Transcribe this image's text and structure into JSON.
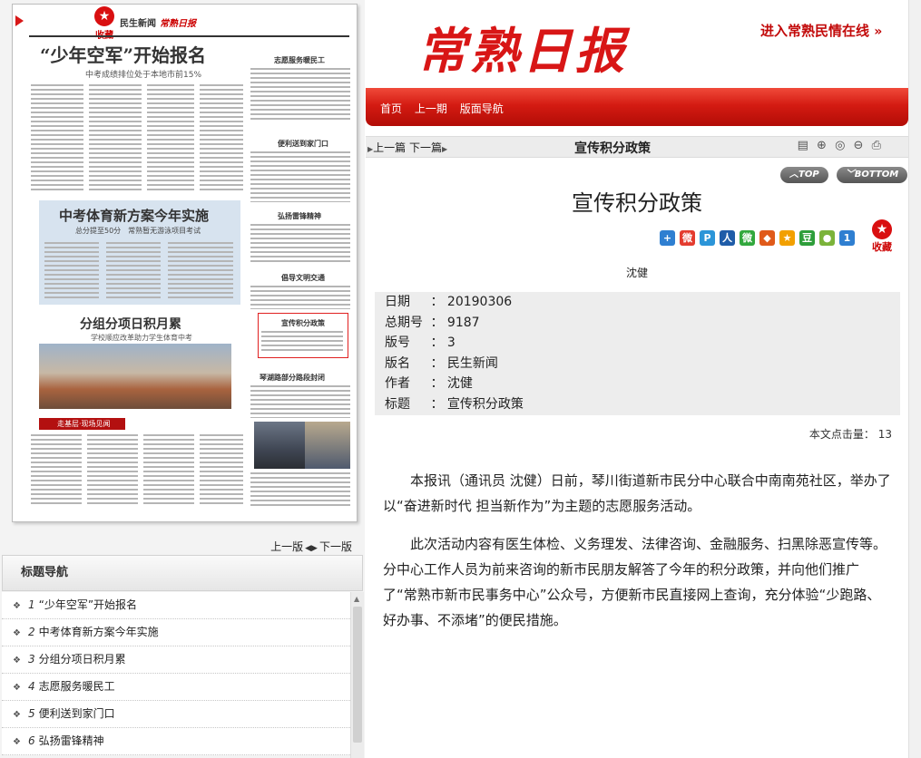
{
  "paper": {
    "fav_label": "收藏",
    "masthead": "民生新闻",
    "masthead_logo": "常熟日报",
    "headline1": "“少年空军”开始报名",
    "headline1_sub": "中考成绩排位处于本地市前15%",
    "headline2": "中考体育新方案今年实施",
    "headline2_sub": "总分提至50分　常熟暂无游泳项目考试",
    "headline3": "分组分项日积月累",
    "headline3_sub": "学校顺应改革助力学生体育中考",
    "banner": "走基层·现场见闻",
    "side_titles": [
      "志愿服务暖民工",
      "便利送到家门口",
      "弘扬雷锋精神",
      "倡导文明交通",
      "宣传积分政策",
      "琴湖路部分路段封闭"
    ]
  },
  "page_nav": {
    "prev": "上一版",
    "next": "下一版"
  },
  "title_nav": {
    "header": "标题导航",
    "items": [
      {
        "num": "1",
        "title": "“少年空军”开始报名"
      },
      {
        "num": "2",
        "title": "中考体育新方案今年实施"
      },
      {
        "num": "3",
        "title": "分组分项日积月累"
      },
      {
        "num": "4",
        "title": "志愿服务暖民工"
      },
      {
        "num": "5",
        "title": "便利送到家门口"
      },
      {
        "num": "6",
        "title": "弘扬雷锋精神"
      }
    ]
  },
  "site": {
    "logo": "常熟日报",
    "top_link": "进入常熟民情在线",
    "nav": [
      "首页",
      "上一期",
      "版面导航"
    ]
  },
  "article_bar": {
    "prev": "上一篇",
    "next": "下一篇",
    "title": "宣传积分政策"
  },
  "scroll_buttons": {
    "top": "TOP",
    "bottom": "BOTTOM"
  },
  "article": {
    "title": "宣传积分政策",
    "fav_label": "收藏",
    "author": "沈健",
    "meta": [
      {
        "k": "日期",
        "v": "20190306"
      },
      {
        "k": "总期号",
        "v": "9187"
      },
      {
        "k": "版号",
        "v": "3"
      },
      {
        "k": "版名",
        "v": "民生新闻"
      },
      {
        "k": "作者",
        "v": "沈健"
      },
      {
        "k": "标题",
        "v": "宣传积分政策"
      }
    ],
    "clicks_label": "本文点击量：",
    "clicks": "13",
    "para1": "本报讯（通讯员 沈健）日前，琴川街道新市民分中心联合中南南苑社区，举办了以“奋进新时代 担当新作为”为主题的志愿服务活动。",
    "para2": "此次活动内容有医生体检、义务理发、法律咨询、金融服务、扫黑除恶宣传等。分中心工作人员为前来咨询的新市民朋友解答了今年的积分政策，并向他们推广了“常熟市新市民事务中心”公众号，方便新市民直接网上查询，充分体验“少跑路、好办事、不添堵”的便民措施。"
  },
  "share_icons": [
    {
      "name": "add-share-icon",
      "glyph": "+",
      "color": "#2f7fd1"
    },
    {
      "name": "weibo-icon",
      "glyph": "微",
      "color": "#e43c2f"
    },
    {
      "name": "qzone-icon",
      "glyph": "P",
      "color": "#2c95d8"
    },
    {
      "name": "renren-icon",
      "glyph": "人",
      "color": "#1f5ca8"
    },
    {
      "name": "wechat-icon",
      "glyph": "微",
      "color": "#32a83d"
    },
    {
      "name": "share-icon-6",
      "glyph": "◆",
      "color": "#e05a1a"
    },
    {
      "name": "share-icon-7",
      "glyph": "★",
      "color": "#f2a000"
    },
    {
      "name": "douban-icon",
      "glyph": "豆",
      "color": "#2e9e3a"
    },
    {
      "name": "share-icon-9",
      "glyph": "●",
      "color": "#7bb33a"
    },
    {
      "name": "share-icon-10",
      "glyph": "1",
      "color": "#2f7fd1"
    }
  ]
}
